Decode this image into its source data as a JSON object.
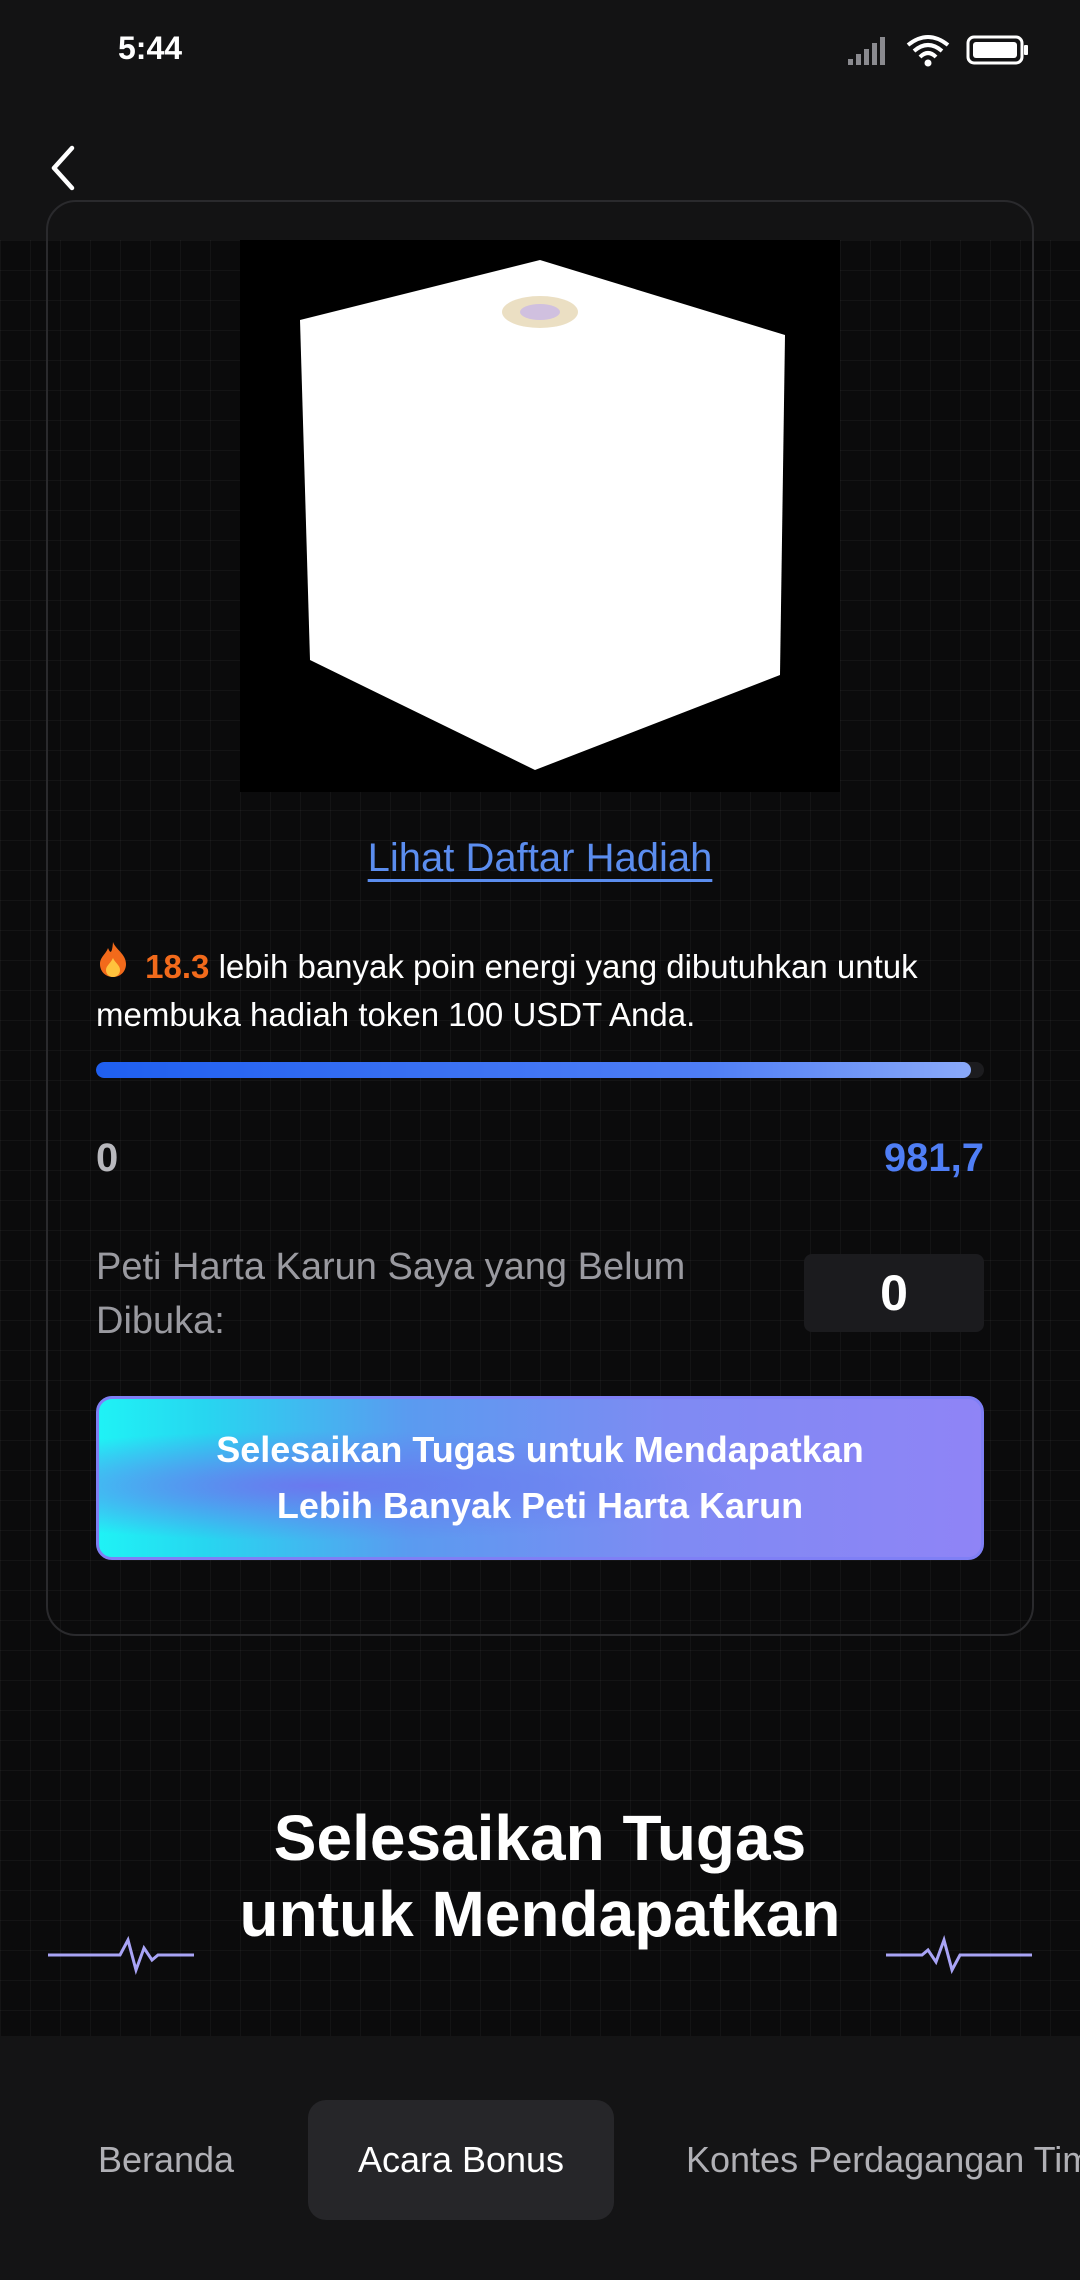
{
  "status_bar": {
    "time": "5:44",
    "icons": [
      "signal-icon",
      "wifi-icon",
      "battery-icon"
    ]
  },
  "header": {
    "back_icon": "chevron-left-icon"
  },
  "chest_card": {
    "reward_link": "Lihat Daftar Hadiah",
    "energy_needed": "18.3",
    "energy_text_suffix": "lebih banyak poin energi yang dibutuhkan untuk membuka hadiah token 100 USDT Anda.",
    "progress": {
      "min_label": "0",
      "max_label": "981,7",
      "fill_fraction": 0.985
    },
    "unopened_label": "Peti Harta Karun Saya yang Belum Dibuka:",
    "unopened_count": "0",
    "cta_label": "Selesaikan Tugas untuk Mendapatkan Lebih Banyak Peti Harta Karun"
  },
  "tasks_section": {
    "title": "Selesaikan Tugas untuk Mendapatkan"
  },
  "tab_bar": {
    "tabs": [
      {
        "label": "Beranda",
        "active": false
      },
      {
        "label": "Acara Bonus",
        "active": true
      },
      {
        "label": "Kontes Perdagangan Tim",
        "active": false
      }
    ]
  },
  "colors": {
    "accent_blue": "#4f7ef5",
    "energy_orange": "#f26a1b",
    "link_blue": "#5b8def"
  }
}
